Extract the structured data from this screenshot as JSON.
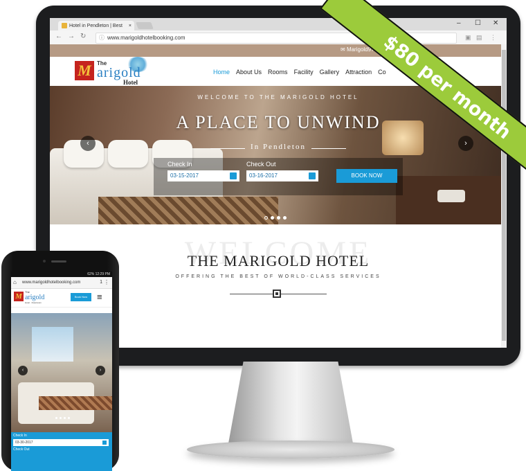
{
  "browser": {
    "tab_title": "Hotel in Pendleton | Best",
    "tab_close": "×",
    "url": "www.marigoldhotelbooking.com",
    "win_min": "–",
    "win_max": "☐",
    "win_close": "✕"
  },
  "site": {
    "email": "Marigold97801@",
    "logo_the": "The",
    "logo_text": "arigold",
    "logo_hotel": "Hotel",
    "nav": [
      "Home",
      "About Us",
      "Rooms",
      "Facility",
      "Gallery",
      "Attraction",
      "Co"
    ],
    "hero": {
      "welcome": "WELCOME TO THE MARIGOLD HOTEL",
      "title": "A PLACE TO UNWIND",
      "subtitle": "In Pendleton",
      "check_in_label": "Check In",
      "check_in_value": "03-15-2017",
      "check_out_label": "Check Out",
      "check_out_value": "03-16-2017",
      "book_button": "BOOK NOW"
    },
    "section": {
      "watermark": "WELCOME",
      "title": "THE MARIGOLD HOTEL",
      "subtitle": "OFFERING THE BEST OF WORLD-CLASS SERVICES"
    }
  },
  "ribbon": {
    "text": "$80 per month",
    "color": "#9ccb3b"
  },
  "phone": {
    "status": "62% 12:29 PM",
    "url": "www.marigoldhotelbooking.com",
    "tab_count": "1",
    "logo_the": "The",
    "logo_text": "arigold",
    "logo_hotel": "Hotel · Downtown",
    "book_button": "Book Now",
    "check_in_label": "Check In",
    "check_in_value": "03-30-2017",
    "check_out_label": "Check Out"
  },
  "colors": {
    "accent": "#1a9bd7",
    "logo_red": "#c5241e",
    "logo_blue": "#2a7fc2"
  }
}
